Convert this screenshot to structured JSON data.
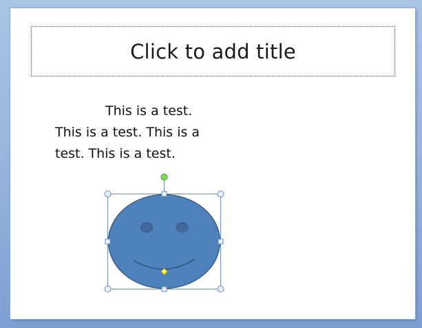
{
  "slide": {
    "title_placeholder": "Click to add title",
    "body_text": "This is a test.  This is a test. This is a test.  This is a test."
  },
  "shape": {
    "kind": "smiley-face",
    "fill_color": "#4f81bd",
    "outline_color": "#385d8a",
    "rotation_handle_color": "#7ed957",
    "adjust_handle_color": "#ffff66",
    "selected": true
  }
}
